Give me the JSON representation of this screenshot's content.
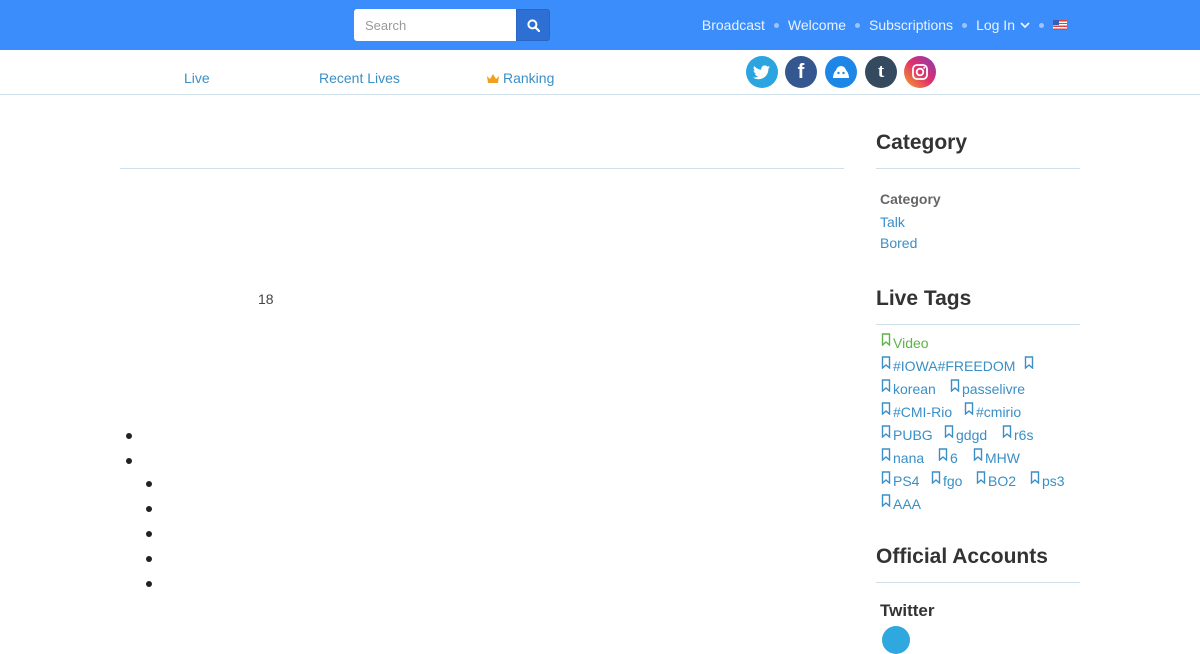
{
  "header": {
    "search": {
      "placeholder": "Search",
      "value": ""
    },
    "nav": {
      "broadcast": "Broadcast",
      "welcome": "Welcome",
      "subscriptions": "Subscriptions",
      "login": "Log In"
    },
    "colors": {
      "bar": "#3a8dfb",
      "link": "#e9f2ff"
    }
  },
  "subnav": {
    "live": "Live",
    "recent": "Recent Lives",
    "ranking": "Ranking",
    "social": [
      "twitter-icon",
      "facebook-icon",
      "cas-icon",
      "tumblr-icon",
      "instagram-icon"
    ]
  },
  "main": {
    "count": "18"
  },
  "sidebar": {
    "category": {
      "heading": "Category",
      "label": "Category",
      "links": [
        "Talk",
        "Bored"
      ]
    },
    "live_tags": {
      "heading": "Live Tags",
      "tags": [
        "Video",
        "#IOWA#FREEDOM",
        "",
        "korean",
        "passelivre",
        "#CMI-Rio",
        "#cmirio",
        "PUBG",
        "gdgd",
        "r6s",
        "nana",
        "6",
        "MHW",
        "PS4",
        "fgo",
        "BO2",
        "ps3",
        "AAA"
      ]
    },
    "official": {
      "heading": "Official Accounts",
      "twitter": "Twitter"
    }
  }
}
